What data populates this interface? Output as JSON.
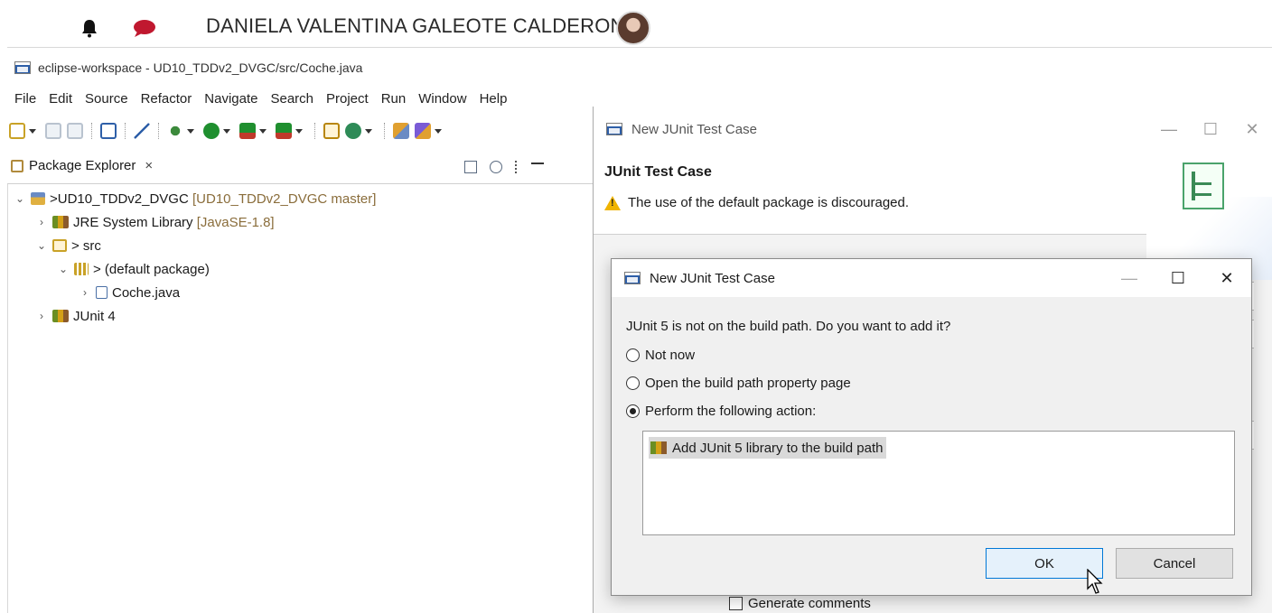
{
  "topbar": {
    "username": "DANIELA VALENTINA GALEOTE CALDERON",
    "icons": [
      "bell-icon",
      "chat-icon",
      "avatar"
    ]
  },
  "window": {
    "title": "eclipse-workspace - UD10_TDDv2_DVGC/src/Coche.java"
  },
  "menu": [
    "File",
    "Edit",
    "Source",
    "Refactor",
    "Navigate",
    "Search",
    "Project",
    "Run",
    "Window",
    "Help"
  ],
  "package_explorer": {
    "tab_label": "Package Explorer",
    "close": "×",
    "tree": {
      "project": {
        "prefix": "> ",
        "label": "UD10_TDDv2_DVGC",
        "decoration": "[UD10_TDDv2_DVGC master]"
      },
      "jre": {
        "label": "JRE System Library",
        "decoration": "[JavaSE-1.8]"
      },
      "src": {
        "label": "> src"
      },
      "package": {
        "label": "> (default package)"
      },
      "file": {
        "label": "Coche.java"
      },
      "junit": {
        "label": "JUnit 4"
      }
    }
  },
  "bg_dialog": {
    "title": "New JUnit Test Case",
    "banner_title": "JUnit Test Case",
    "banner_message": "The use of the default package is discouraged.",
    "generate_comments": "Generate comments"
  },
  "modal": {
    "title": "New JUnit Test Case",
    "question": "JUnit 5 is not on the build path. Do you want to add it?",
    "options": [
      {
        "label": "Not now",
        "selected": false
      },
      {
        "label": "Open the build path property page",
        "selected": false
      },
      {
        "label": "Perform the following action:",
        "selected": true
      }
    ],
    "action_item": "Add JUnit 5 library to the build path",
    "ok": "OK",
    "cancel": "Cancel",
    "window_controls": {
      "minimize": "—",
      "maximize": "☐",
      "close": "✕"
    }
  },
  "colors": {
    "accent": "#0078d7",
    "warning": "#f0b400",
    "git_decoration": "#8a6d3b"
  }
}
